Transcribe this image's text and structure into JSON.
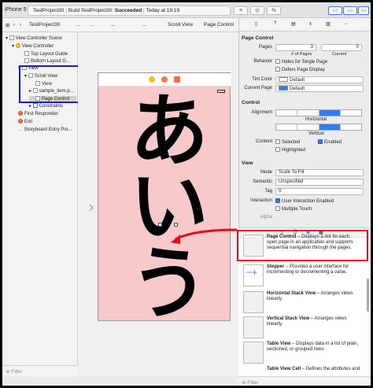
{
  "toolbar": {
    "scheme": "iPhone 5",
    "status_project": "TestProject30",
    "status_build": "Build TestProject30:",
    "status_result": "Succeeded",
    "status_time": "Today at 19:19"
  },
  "jumpbar": {
    "items": [
      "TestProject30",
      "...",
      "...",
      "...",
      "...",
      "Scroll View",
      "Page Control"
    ]
  },
  "navigator": {
    "rows": [
      "View Controller Scene",
      "View Controller",
      "Top Layout Guide",
      "Bottom Layout G...",
      "View",
      "Scroll View",
      "View",
      "sample_item.p...",
      "Page Control",
      "Constraints",
      "First Responder",
      "Exit",
      "Storyboard Entry Poi..."
    ],
    "filter_placeholder": "Filter"
  },
  "canvas": {
    "text": [
      "あ",
      "い",
      "う"
    ]
  },
  "inspector": {
    "page_control_title": "Page Control",
    "pages_label": "Pages",
    "pages_value": "3",
    "current_value": "0",
    "pages_sub": "# of Pages",
    "current_sub": "Current",
    "behavior_label": "Behavior",
    "hides_single": "Hides for Single Page",
    "defers": "Defers Page Display",
    "tint_label": "Tint Color",
    "tint_value": "Default",
    "current_page_label": "Current Page",
    "current_page_value": "Default",
    "control_title": "Control",
    "alignment_label": "Alignment",
    "horizontal": "Horizontal",
    "vertical": "Vertical",
    "content_label": "Content",
    "selected": "Selected",
    "enabled": "Enabled",
    "highlighted": "Highlighted",
    "view_title": "View",
    "mode_label": "Mode",
    "mode_value": "Scale To Fill",
    "semantic_label": "Semantic",
    "semantic_value": "Unspecified",
    "tag_label": "Tag",
    "tag_value": "0",
    "interaction_label": "Interaction",
    "user_interaction": "User Interaction Enabled",
    "multiple_touch": "Multiple Touch",
    "alpha_label": "Alpha"
  },
  "library": {
    "items": [
      {
        "name": "Page Control",
        "desc": " – Displays a dot for each open page in an application and supports sequential navigation through the pages."
      },
      {
        "name": "Stepper",
        "desc": " – Provides a user interface for incrementing or decrementing a value."
      },
      {
        "name": "Horizontal Stack View",
        "desc": " – Arranges views linearly."
      },
      {
        "name": "Vertical Stack View",
        "desc": " – Arranges views linearly."
      },
      {
        "name": "Table View",
        "desc": " – Displays data in a list of plain, sectioned, or grouped rows."
      },
      {
        "name": "Table View Cell",
        "desc": " – Defines the attributes and"
      }
    ],
    "filter_placeholder": "Filter"
  },
  "colors": {
    "accent": "#2f7ef5",
    "annotation_red": "#e0101a",
    "annotation_blue": "#1a1ab8",
    "view_bg": "#f7c9cb"
  }
}
